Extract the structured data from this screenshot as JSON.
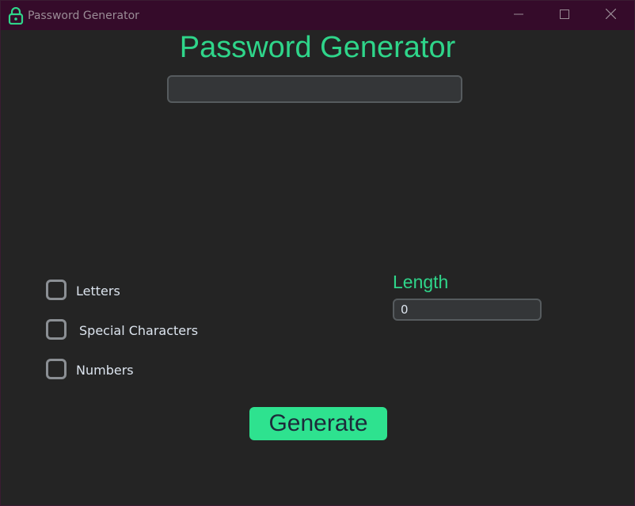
{
  "window": {
    "title": "Password Generator",
    "controls": {
      "minimize_icon": "minimize-icon",
      "maximize_icon": "maximize-icon",
      "close_icon": "close-icon"
    },
    "app_icon": "lock-icon"
  },
  "main": {
    "heading": "Password Generator",
    "password_output": {
      "value": "",
      "placeholder": ""
    },
    "options": [
      {
        "label": "Letters",
        "checked": false
      },
      {
        "label": "Special Characters",
        "checked": false
      },
      {
        "label": "Numbers",
        "checked": false
      }
    ],
    "length": {
      "label": "Length",
      "value": "0"
    },
    "generate_label": "Generate"
  },
  "colors": {
    "accent": "#2fd58a",
    "button_bg": "#2ee28f",
    "titlebar_bg": "#350b2a",
    "window_bg": "#242424"
  }
}
